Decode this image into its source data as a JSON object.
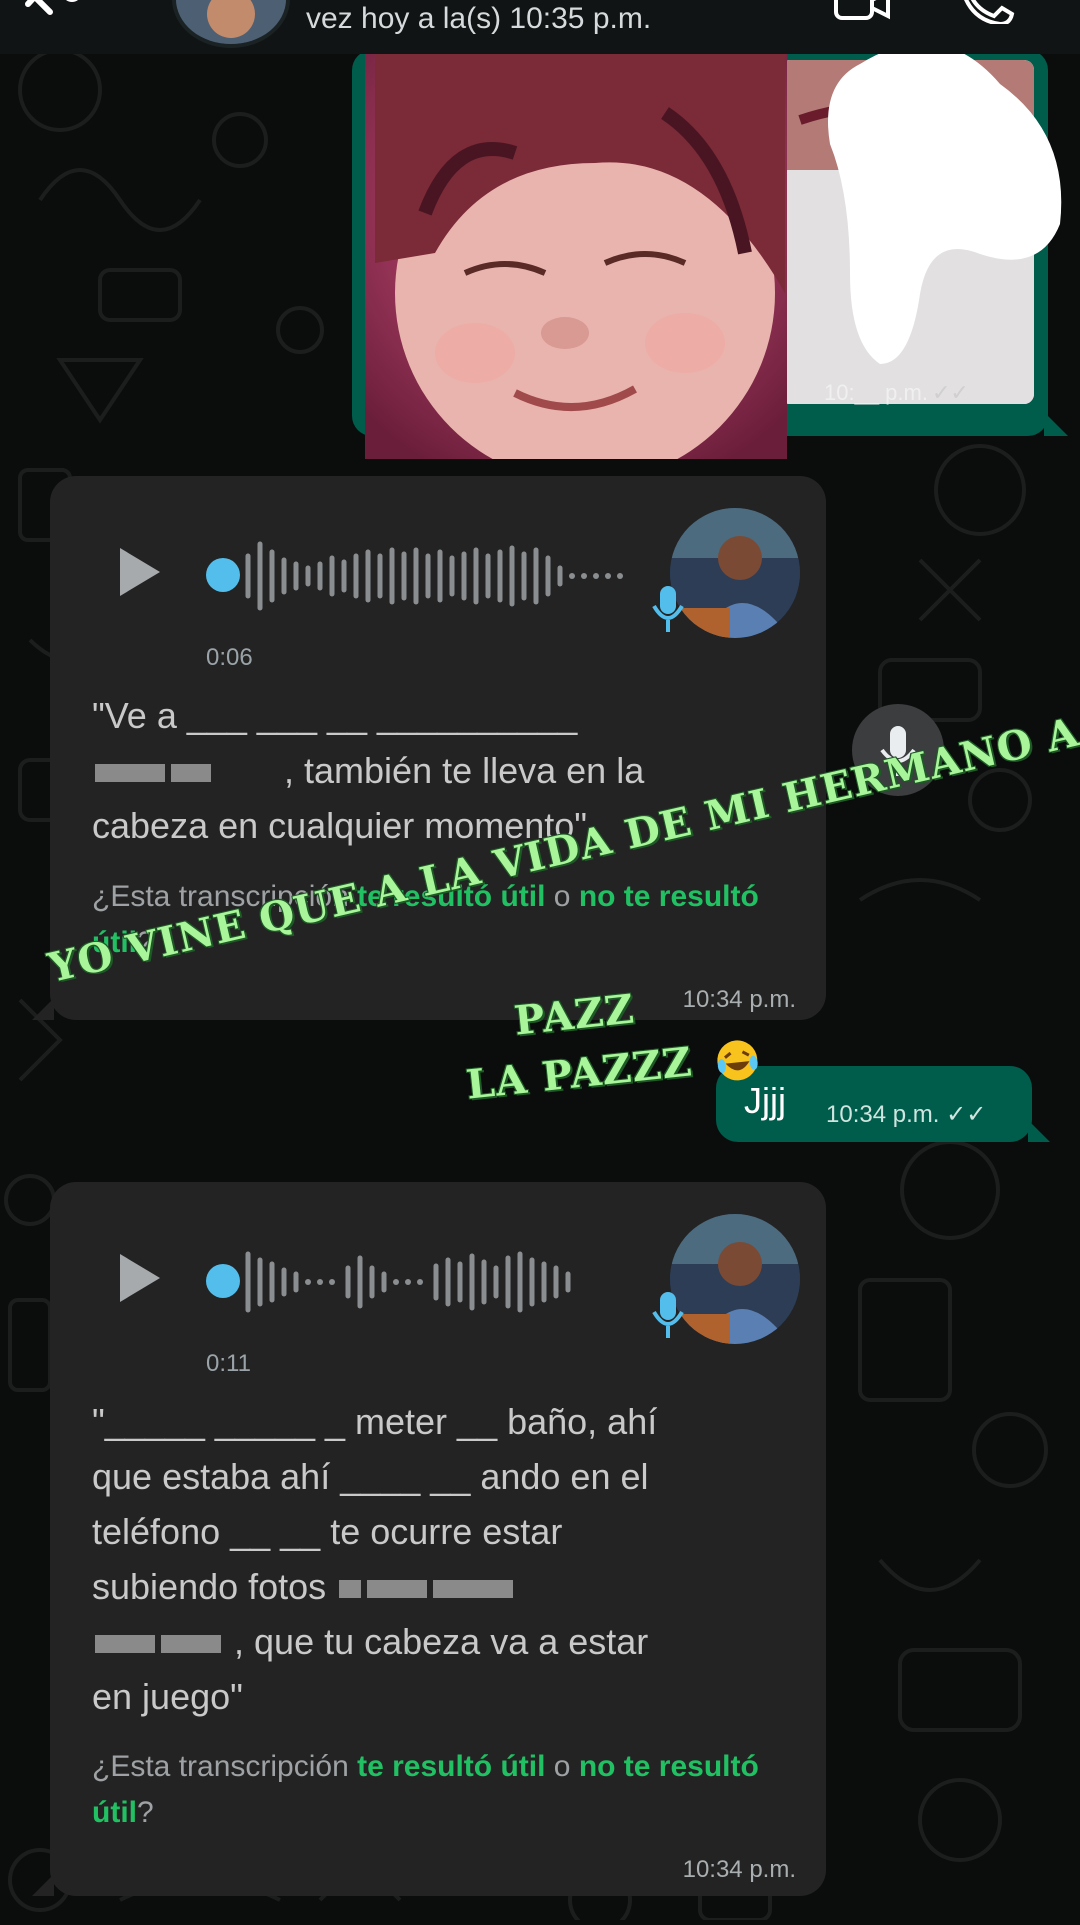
{
  "header": {
    "status": "vez hoy a la(s) 10:35 p.m."
  },
  "image_message": {
    "time": "10:__ p.m.",
    "ticks": "✓✓"
  },
  "audio_1": {
    "duration": "0:06",
    "transcript_parts": [
      "\"Ve a ___ ___ __ __________",
      ", también te lleva en la",
      "cabeza en cualquier momento\""
    ],
    "feedback_prefix": "¿Esta transcripción ",
    "feedback_yes": "te resultó útil",
    "feedback_or": " o ",
    "feedback_no": "no te resultó útil",
    "feedback_suffix": "?",
    "time": "10:34 p.m."
  },
  "outgoing_text": {
    "text": "Jjjj",
    "time": "10:34 p.m.",
    "ticks": "✓✓"
  },
  "audio_2": {
    "duration": "0:11",
    "transcript_lines": [
      "\"_____ _____ _ meter __ baño, ahí",
      "que estaba ahí ____ __ ando en el",
      "teléfono __ __ te ocurre estar",
      "subiendo fotos",
      ", que tu cabeza va a estar",
      "en juego\""
    ],
    "feedback_prefix": "¿Esta transcripción ",
    "feedback_yes": "te resultó útil",
    "feedback_or": " o ",
    "feedback_no": "no te resultó útil",
    "feedback_suffix": "?",
    "time": "10:34 p.m."
  },
  "overlay_text": {
    "line1": "YO VINE QUE A LA VIDA DE MI HERMANO A DARLE",
    "line2": "PAZZ",
    "line3": "LA PAZZZ"
  },
  "icons": [
    "back-icon",
    "video-call-icon",
    "phone-call-icon",
    "play-icon",
    "microphone-icon",
    "laughing-emoji-icon"
  ],
  "colors": {
    "outgoing_bubble": "#005c4b",
    "incoming_bubble": "#232323",
    "accent_green": "#21c063",
    "progress_blue": "#53bdeb",
    "overlay_text": "#a9f59a"
  }
}
